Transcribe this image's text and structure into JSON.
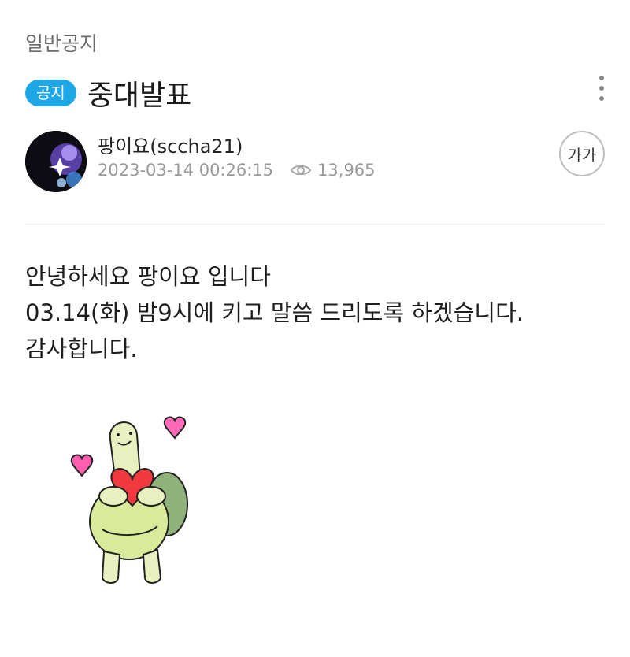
{
  "category": "일반공지",
  "badge": "공지",
  "title": "중대발표",
  "author": "팡이요(sccha21)",
  "datetime": "2023-03-14 00:26:15",
  "views": "13,965",
  "font_toggle": "가가",
  "body_lines": [
    "안녕하세요 팡이요 입니다",
    "03.14(화) 밤9시에 키고 말씀 드리도록 하겠습니다.",
    "감사합니다."
  ],
  "colors": {
    "badge_bg": "#1ea7e6",
    "text_muted": "#9a9a9a"
  },
  "icons": {
    "more": "more-vertical-icon",
    "views": "eye-icon"
  }
}
